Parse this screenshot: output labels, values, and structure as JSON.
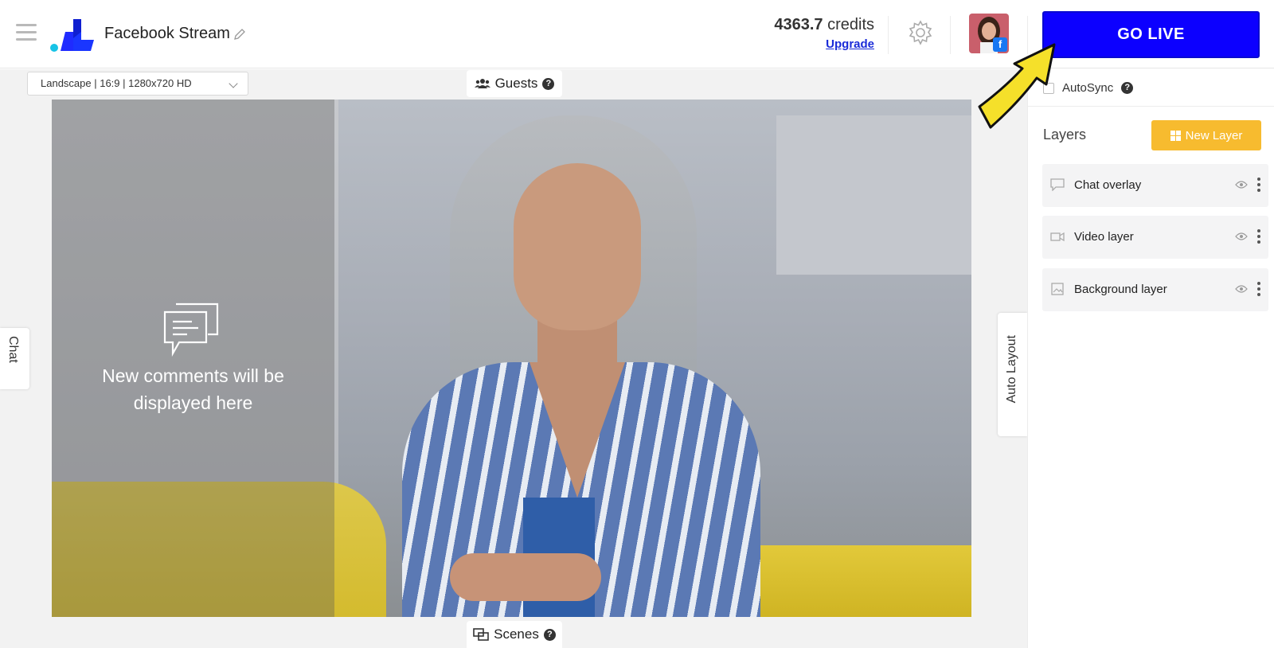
{
  "header": {
    "stream_title": "Facebook Stream",
    "credits_amount": "4363.7",
    "credits_label": "credits",
    "upgrade_label": "Upgrade",
    "go_live_label": "GO LIVE",
    "platform_badge": "f"
  },
  "stage": {
    "resolution": "Landscape | 16:9 | 1280x720 HD",
    "guests_label": "Guests",
    "scenes_label": "Scenes",
    "chat_tab_label": "Chat",
    "auto_layout_label": "Auto Layout",
    "help_glyph": "?",
    "chat_overlay_message_line1": "New comments will be",
    "chat_overlay_message_line2": "displayed here"
  },
  "panel": {
    "autosync_label": "AutoSync",
    "layers_title": "Layers",
    "new_layer_label": "New Layer",
    "layers": [
      {
        "name": "Chat overlay",
        "icon": "chat-icon"
      },
      {
        "name": "Video layer",
        "icon": "video-icon"
      },
      {
        "name": "Background layer",
        "icon": "image-icon"
      }
    ]
  },
  "colors": {
    "go_live": "#0c00ff",
    "new_layer": "#f7bb2f",
    "upgrade_link": "#1a2bd8",
    "annotation_arrow": "#f5e02a"
  }
}
